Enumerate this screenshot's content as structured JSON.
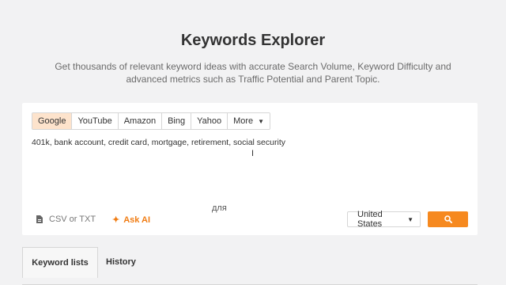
{
  "header": {
    "title": "Keywords Explorer",
    "subtitle": "Get thousands of relevant keyword ideas with accurate Search Volume, Keyword Difficulty and advanced metrics such as Traffic Potential and Parent Topic."
  },
  "search_engines": {
    "tabs": [
      "Google",
      "YouTube",
      "Amazon",
      "Bing",
      "Yahoo",
      "More"
    ],
    "active": "Google"
  },
  "keywords_input": {
    "value": "401k, bank account, credit card, mortgage, retirement, social security"
  },
  "overlay_text": "для",
  "actions": {
    "csv_label": "CSV or TXT",
    "ask_ai_label": "Ask AI"
  },
  "country": {
    "selected": "United States"
  },
  "bottom_tabs": {
    "keyword_lists": "Keyword lists",
    "history": "History",
    "active": "Keyword lists"
  },
  "colors": {
    "accent": "#f6891f",
    "active_tab_bg": "#fde3cc",
    "page_bg": "#f2f2f3"
  },
  "icons": {
    "more_caret": "caret-down-icon",
    "csv": "file-icon",
    "ask_ai": "sparkle-icon",
    "search": "search-icon"
  }
}
